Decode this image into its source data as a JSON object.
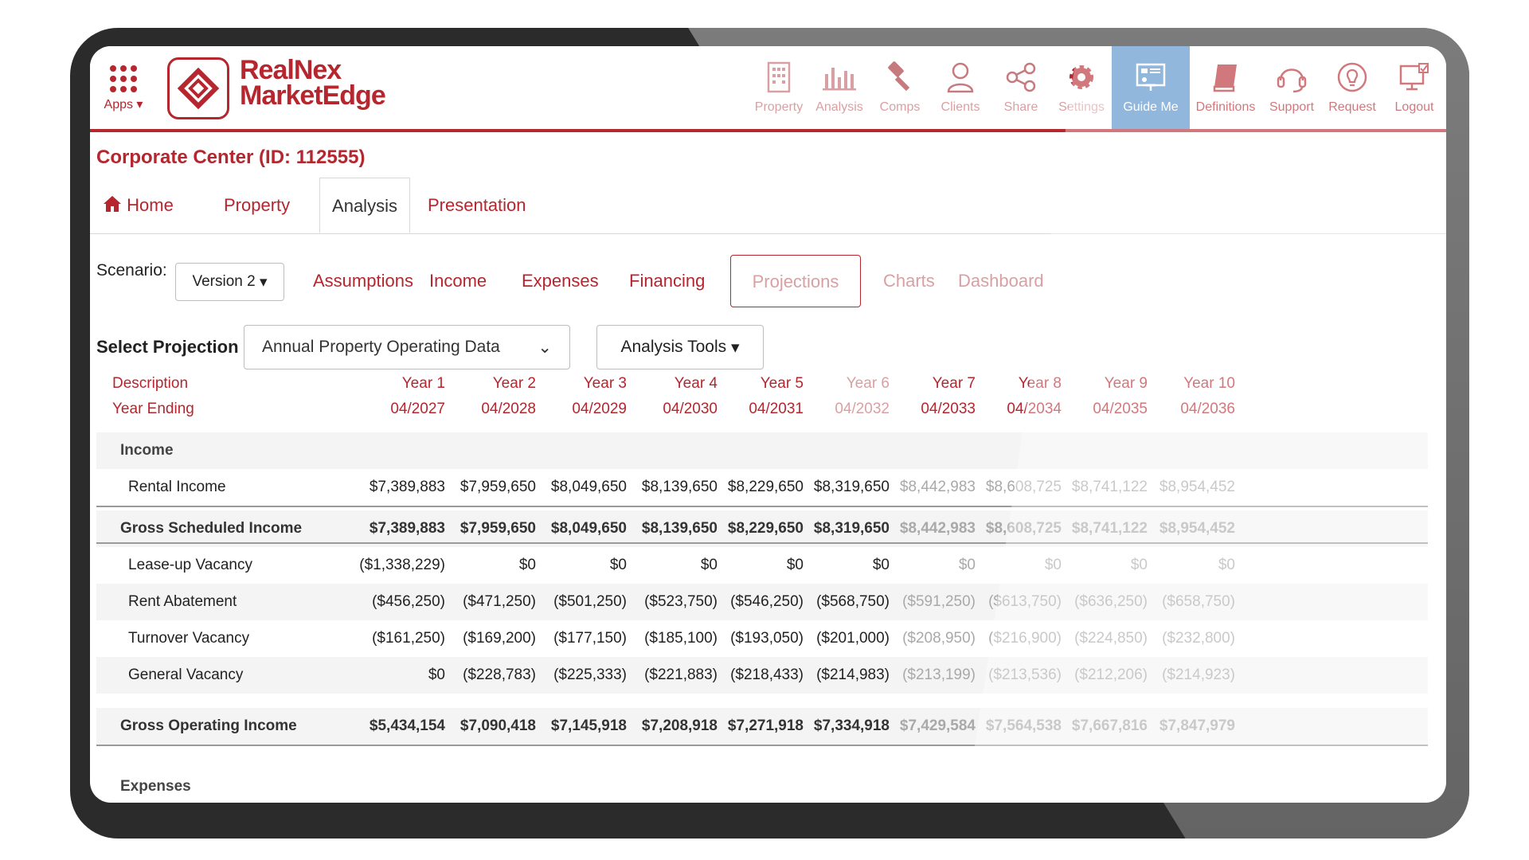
{
  "app": {
    "apps_label": "Apps",
    "logo_line1": "RealNex",
    "logo_line2": "MarketEdge"
  },
  "nav": [
    {
      "label": "Property",
      "icon": "building-icon"
    },
    {
      "label": "Analysis",
      "icon": "bar-chart-icon"
    },
    {
      "label": "Comps",
      "icon": "gavel-icon"
    },
    {
      "label": "Clients",
      "icon": "person-icon"
    },
    {
      "label": "Share",
      "icon": "share-icon"
    },
    {
      "label": "Settings",
      "icon": "gear-icon"
    },
    {
      "label": "Guide Me",
      "icon": "guide-icon"
    },
    {
      "label": "Definitions",
      "icon": "book-icon"
    },
    {
      "label": "Support",
      "icon": "headset-icon"
    },
    {
      "label": "Request",
      "icon": "lightbulb-icon"
    },
    {
      "label": "Logout",
      "icon": "logout-icon"
    }
  ],
  "page_title": "Corporate Center (ID: 112555)",
  "tabs": [
    "Home",
    "Property",
    "Analysis",
    "Presentation"
  ],
  "scenario": {
    "label": "Scenario:",
    "value": "Version 2"
  },
  "subtabs": [
    "Assumptions",
    "Income",
    "Expenses",
    "Financing",
    "Projections",
    "Charts",
    "Dashboard"
  ],
  "projection": {
    "label": "Select Projection",
    "value": "Annual Property Operating Data",
    "tools_label": "Analysis Tools"
  },
  "table": {
    "header_desc": "Description",
    "header_year_ending": "Year Ending",
    "years": [
      "Year 1",
      "Year 2",
      "Year 3",
      "Year 4",
      "Year 5",
      "Year 6",
      "Year 7",
      "Year 8",
      "Year 9",
      "Year 10"
    ],
    "dates": [
      "04/2027",
      "04/2028",
      "04/2029",
      "04/2030",
      "04/2031",
      "04/2032",
      "04/2033",
      "04/2034",
      "04/2035",
      "04/2036"
    ],
    "income_section": "Income",
    "rows": [
      {
        "label": "Rental Income",
        "values": [
          "$7,389,883",
          "$7,959,650",
          "$8,049,650",
          "$8,139,650",
          "$8,229,650",
          "$8,319,650",
          "$8,442,983",
          "$8,608,725",
          "$8,741,122",
          "$8,954,452"
        ]
      },
      {
        "label": "Gross Scheduled Income",
        "values": [
          "$7,389,883",
          "$7,959,650",
          "$8,049,650",
          "$8,139,650",
          "$8,229,650",
          "$8,319,650",
          "$8,442,983",
          "$8,608,725",
          "$8,741,122",
          "$8,954,452"
        ]
      },
      {
        "label": "Lease-up Vacancy",
        "values": [
          "($1,338,229)",
          "$0",
          "$0",
          "$0",
          "$0",
          "$0",
          "$0",
          "$0",
          "$0",
          "$0"
        ]
      },
      {
        "label": "Rent Abatement",
        "values": [
          "($456,250)",
          "($471,250)",
          "($501,250)",
          "($523,750)",
          "($546,250)",
          "($568,750)",
          "($591,250)",
          "($613,750)",
          "($636,250)",
          "($658,750)"
        ]
      },
      {
        "label": "Turnover Vacancy",
        "values": [
          "($161,250)",
          "($169,200)",
          "($177,150)",
          "($185,100)",
          "($193,050)",
          "($201,000)",
          "($208,950)",
          "($216,900)",
          "($224,850)",
          "($232,800)"
        ]
      },
      {
        "label": "General Vacancy",
        "values": [
          "$0",
          "($228,783)",
          "($225,333)",
          "($221,883)",
          "($218,433)",
          "($214,983)",
          "($213,199)",
          "($213,536)",
          "($212,206)",
          "($214,923)"
        ]
      },
      {
        "label": "Gross Operating Income",
        "values": [
          "$5,434,154",
          "$7,090,418",
          "$7,145,918",
          "$7,208,918",
          "$7,271,918",
          "$7,334,918",
          "$7,429,584",
          "$7,564,538",
          "$7,667,816",
          "$7,847,979"
        ]
      }
    ],
    "expenses_section": "Expenses"
  }
}
